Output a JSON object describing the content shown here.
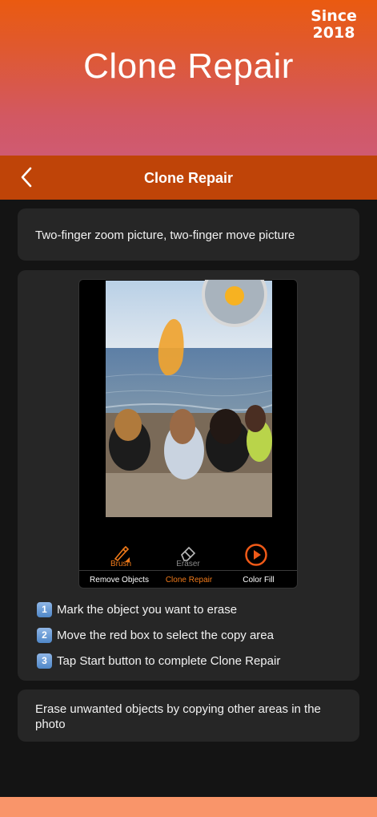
{
  "banner": {
    "title": "Clone Repair",
    "since_label": "Since",
    "since_year": "2018"
  },
  "navbar": {
    "title": "Clone Repair",
    "back_icon": "chevron-left-icon"
  },
  "tip_card": {
    "text": "Two-finger zoom picture, two-finger move picture"
  },
  "preview": {
    "tools": [
      {
        "label": "Brush",
        "icon": "brush-icon",
        "active": true
      },
      {
        "label": "Eraser",
        "icon": "eraser-icon",
        "active": false
      },
      {
        "label": "",
        "icon": "play-circle-icon",
        "active": true
      }
    ],
    "tabs": [
      {
        "label": "Remove Objects",
        "active": false
      },
      {
        "label": "Clone Repair",
        "active": true
      },
      {
        "label": "Color Fill",
        "active": false
      }
    ]
  },
  "steps": [
    {
      "num": "1",
      "text": "Mark the object you want to erase"
    },
    {
      "num": "2",
      "text": "Move the red box to select the copy area"
    },
    {
      "num": "3",
      "text": "Tap Start button to complete Clone Repair"
    }
  ],
  "description_card": {
    "text": "Erase unwanted objects by copying other areas in the photo"
  },
  "colors": {
    "accent": "#f07a1a",
    "navbar": "#bf4408",
    "card": "#262626",
    "background": "#141414"
  }
}
